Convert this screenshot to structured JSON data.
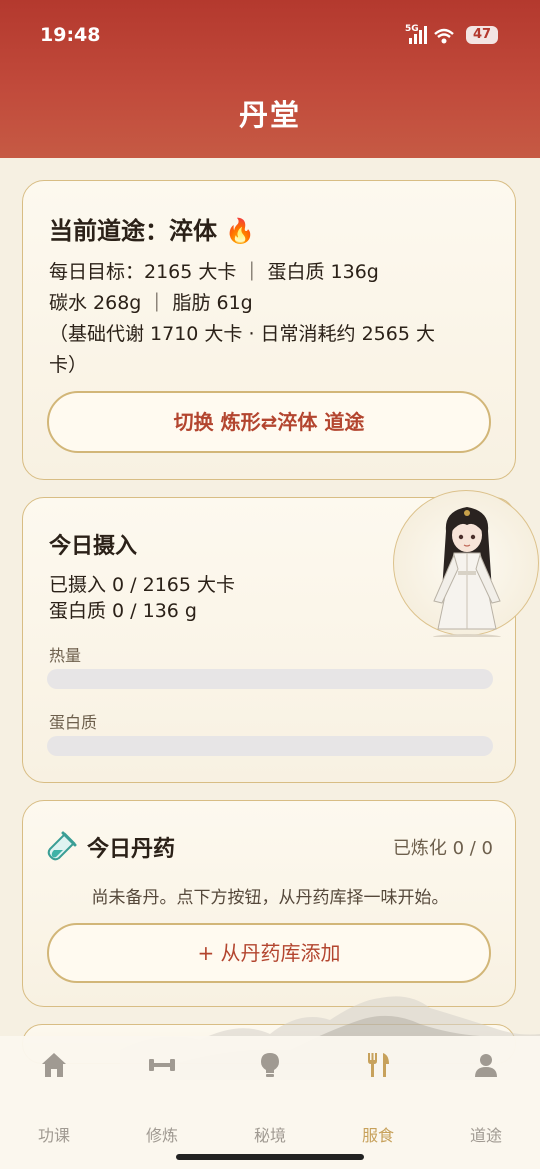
{
  "status_bar": {
    "time": "19:48",
    "network": "5G",
    "battery": "47"
  },
  "header": {
    "title": "丹堂"
  },
  "path_card": {
    "title": "当前道途：淬体 🔥",
    "daily_goal": "每日目标：2165 大卡 ｜ 蛋白质 136g",
    "macros": "碳水 268g ｜ 脂肪 61g",
    "note_line1": "（基础代谢 1710 大卡 · 日常消耗约 2565 大",
    "note_line2": "卡）",
    "switch_label": "切换 炼形⇄淬体 道途"
  },
  "intake_card": {
    "title": "今日摄入",
    "calories_text": "已摄入 0 / 2165 大卡",
    "protein_text": "蛋白质 0 / 136 g",
    "calories_label": "热量",
    "protein_label": "蛋白质",
    "calories_progress": 0,
    "protein_progress": 0
  },
  "pill_card": {
    "title": "今日丹药",
    "status": "已炼化 0 / 0",
    "empty_text": "尚未备丹。点下方按钮，从丹药库择一味开始。",
    "add_label": "+ 从丹药库添加"
  },
  "nav": {
    "items": [
      {
        "label": "功课",
        "icon": "home-icon"
      },
      {
        "label": "修炼",
        "icon": "dumbbell-icon"
      },
      {
        "label": "秘境",
        "icon": "lightbulb-icon"
      },
      {
        "label": "服食",
        "icon": "utensils-icon",
        "active": true
      },
      {
        "label": "道途",
        "icon": "user-icon"
      }
    ]
  },
  "colors": {
    "header": "#b4392e",
    "accent": "#b3452f",
    "nav_active": "#c7a15b",
    "card_border": "#d8bd84"
  }
}
